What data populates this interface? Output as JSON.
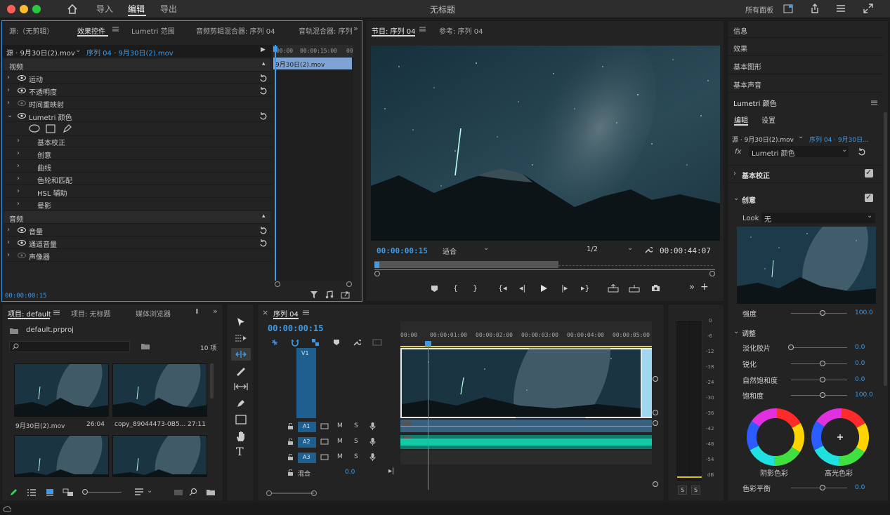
{
  "app": {
    "title": "无标题",
    "workspace_tabs": [
      "导入",
      "编辑",
      "导出"
    ],
    "active_workspace": "编辑",
    "right_label": "所有面板"
  },
  "source_panel": {
    "tabs": [
      "源:（无剪辑）",
      "效果控件",
      "Lumetri 范围",
      "音频剪辑混合器: 序列 04",
      "音轨混合器: 序列"
    ],
    "clip_source": "源 · 9月30日(2).mov",
    "clip_seq": "序列 04 · 9月30日(2).mov",
    "time_ruler": [
      "00:00",
      "00:00:15:00",
      "00"
    ],
    "clip_block": "9月30日(2).mov",
    "sections": {
      "video": "视频",
      "audio": "音频"
    },
    "video_rows": [
      "运动",
      "不透明度",
      "时间重映射",
      "Lumetri 颜色"
    ],
    "lumetri_sub": [
      "基本校正",
      "创意",
      "曲线",
      "色轮和匹配",
      "HSL 辅助",
      "晕影"
    ],
    "audio_rows": [
      "音量",
      "通道音量",
      "声像器"
    ],
    "timecode": "00:00:00:15"
  },
  "program_panel": {
    "tabs": [
      "节目: 序列 04",
      "参考: 序列 04"
    ],
    "timecode": "00:00:00:15",
    "fit": "适合",
    "ratio": "1/2",
    "duration": "00:00:44:07"
  },
  "project_panel": {
    "tabs": [
      "项目: default",
      "项目: 无标题",
      "媒体浏览器",
      "Ⅱ"
    ],
    "project_file": "default.prproj",
    "item_count": "10 项",
    "items": [
      {
        "name": "9月30日(2).mov",
        "duration": "26:04"
      },
      {
        "name": "copy_89044473-0B5...",
        "duration": "27:11"
      },
      {
        "name": "",
        "duration": ""
      },
      {
        "name": "",
        "duration": ""
      }
    ]
  },
  "timeline": {
    "tab": "序列 04",
    "timecode": "00:00:00:15",
    "ruler": [
      "00:00",
      "00:00:01:00",
      "00:00:02:00",
      "00:00:03:00",
      "00:00:04:00",
      "00:00:05:00"
    ],
    "video_track": "V1",
    "audio_tracks": [
      "A1",
      "A2",
      "A3"
    ],
    "mix_label": "混合",
    "mix_value": "0.0",
    "mute": "M",
    "solo": "S"
  },
  "meter": {
    "scale": [
      "0",
      "-6",
      "-12",
      "-18",
      "-24",
      "-30",
      "-36",
      "-42",
      "-48",
      "-54",
      "dB"
    ],
    "buttons": [
      "S",
      "S"
    ]
  },
  "right_panel": {
    "items": [
      "信息",
      "效果",
      "基本图形",
      "基本声音",
      "Lumetri 颜色"
    ],
    "lum_tabs": [
      "编辑",
      "设置"
    ],
    "clip_source": "源 · 9月30日(2).mov",
    "clip_seq": "序列 04 · 9月30日...",
    "fx_label": "fx",
    "effect": "Lumetri 颜色",
    "basic": "基本校正",
    "creative": "创意",
    "look_label": "Look",
    "look_value": "无",
    "intensity": {
      "label": "强度",
      "value": "100.0"
    },
    "adjust": "调整",
    "sliders": [
      {
        "label": "淡化胶片",
        "value": "0.0"
      },
      {
        "label": "锐化",
        "value": "0.0"
      },
      {
        "label": "自然饱和度",
        "value": "0.0"
      },
      {
        "label": "饱和度",
        "value": "100.0"
      }
    ],
    "wheel_labels": [
      "阴影色彩",
      "高光色彩"
    ],
    "balance": {
      "label": "色彩平衡",
      "value": "0.0"
    }
  },
  "colors": {
    "accent_blue": "#3d9be9",
    "audio_green": "#13c9a6",
    "track_blue": "#1f5f8f"
  }
}
